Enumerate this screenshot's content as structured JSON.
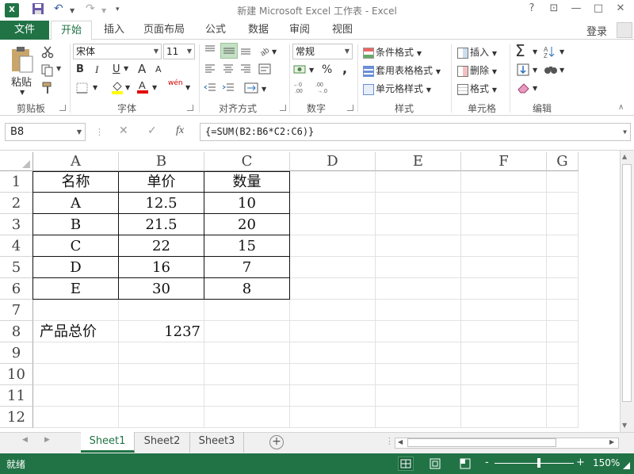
{
  "window": {
    "title": "新建 Microsoft Excel 工作表 - Excel",
    "logo": "X",
    "help": "?",
    "minimize": "—",
    "restore": "□",
    "close": "✕"
  },
  "tabs": {
    "file": "文件",
    "home": "开始",
    "insert": "插入",
    "layout": "页面布局",
    "formulas": "公式",
    "data": "数据",
    "review": "审阅",
    "view": "视图"
  },
  "user": {
    "login": "登录"
  },
  "ribbon": {
    "clipboard": {
      "label": "剪贴板",
      "paste": "粘贴"
    },
    "font": {
      "label": "字体",
      "name": "宋体",
      "size": "11",
      "bold": "B",
      "italic": "I",
      "underline": "U",
      "grow": "A",
      "shrink": "A",
      "wen": "wén"
    },
    "alignment": {
      "label": "对齐方式"
    },
    "number": {
      "label": "数字",
      "format": "常规",
      "percent": "%",
      "comma": ","
    },
    "styles": {
      "label": "样式",
      "cond": "条件格式",
      "table": "套用表格格式",
      "cell": "单元格样式"
    },
    "cells": {
      "label": "单元格",
      "insert": "插入",
      "delete": "删除",
      "format": "格式"
    },
    "editing": {
      "label": "编辑"
    }
  },
  "formula_bar": {
    "name_box": "B8",
    "formula": "{=SUM(B2:B6*C2:C6)}",
    "fx": "fx",
    "cancel": "✕",
    "enter": "✓"
  },
  "columns": [
    "A",
    "B",
    "C",
    "D",
    "E",
    "F",
    "G"
  ],
  "rows": [
    "1",
    "2",
    "3",
    "4",
    "5",
    "6",
    "7",
    "8",
    "9",
    "10",
    "11",
    "12"
  ],
  "table": {
    "header": [
      "名称",
      "单价",
      "数量"
    ],
    "rows": [
      [
        "A",
        "12.5",
        "10"
      ],
      [
        "B",
        "21.5",
        "20"
      ],
      [
        "C",
        "22",
        "15"
      ],
      [
        "D",
        "16",
        "7"
      ],
      [
        "E",
        "30",
        "8"
      ]
    ]
  },
  "total": {
    "label": "产品总价",
    "value": "1237"
  },
  "sheets": [
    "Sheet1",
    "Sheet2",
    "Sheet3"
  ],
  "status": {
    "ready": "就绪",
    "zoom": "150%",
    "minus": "-",
    "plus": "+"
  },
  "colors": {
    "accent": "#217346"
  }
}
